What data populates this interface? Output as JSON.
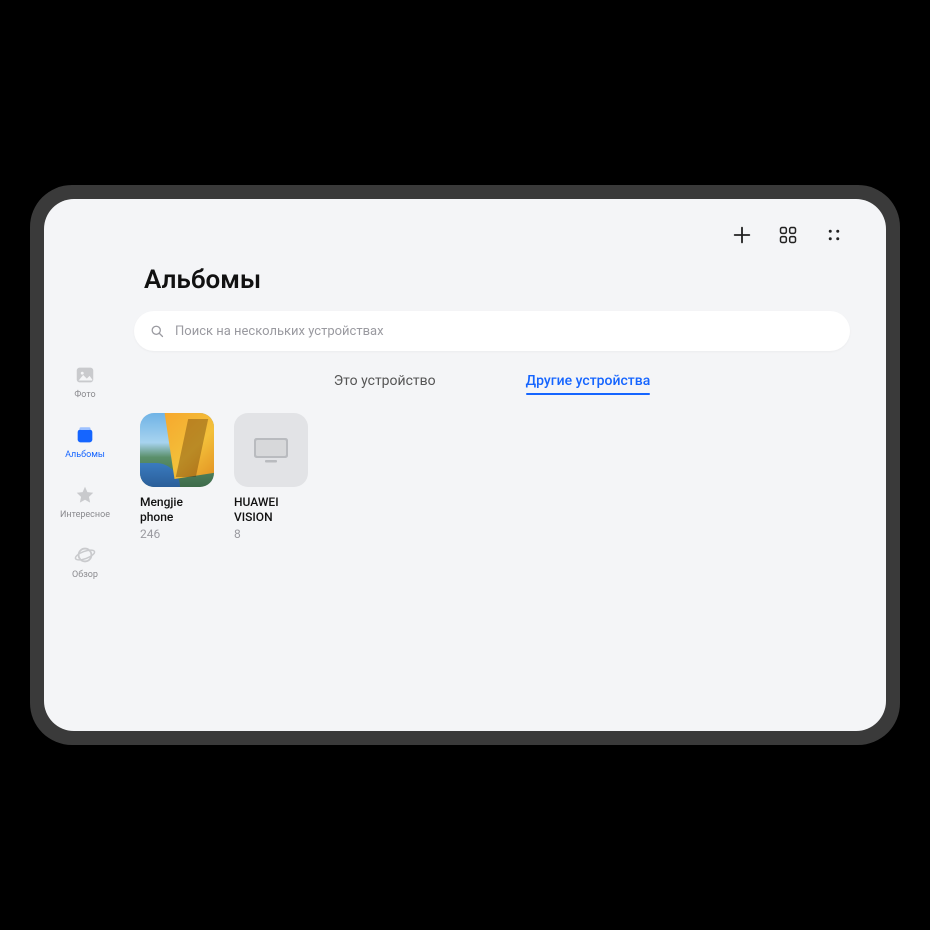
{
  "page": {
    "title": "Альбомы"
  },
  "search": {
    "placeholder": "Поиск на нескольких устройствах"
  },
  "sidebar": {
    "items": [
      {
        "id": "photos",
        "label": "Фото"
      },
      {
        "id": "albums",
        "label": "Альбомы"
      },
      {
        "id": "interesting",
        "label": "Интересное"
      },
      {
        "id": "overview",
        "label": "Обзор"
      }
    ],
    "active_index": 1
  },
  "tabs": {
    "items": [
      {
        "id": "this-device",
        "label": "Это устройство"
      },
      {
        "id": "other-devices",
        "label": "Другие устройства"
      }
    ],
    "active_index": 1
  },
  "albums": [
    {
      "id": "mengjie-phone",
      "name": "Mengjie phone",
      "count": 246,
      "thumb": "photo"
    },
    {
      "id": "huawei-vision",
      "name": "HUAWEI VISION",
      "count": 8,
      "thumb": "tv"
    }
  ],
  "colors": {
    "accent": "#1565ff",
    "bg": "#f4f5f7",
    "muted": "#9a9aa0"
  }
}
